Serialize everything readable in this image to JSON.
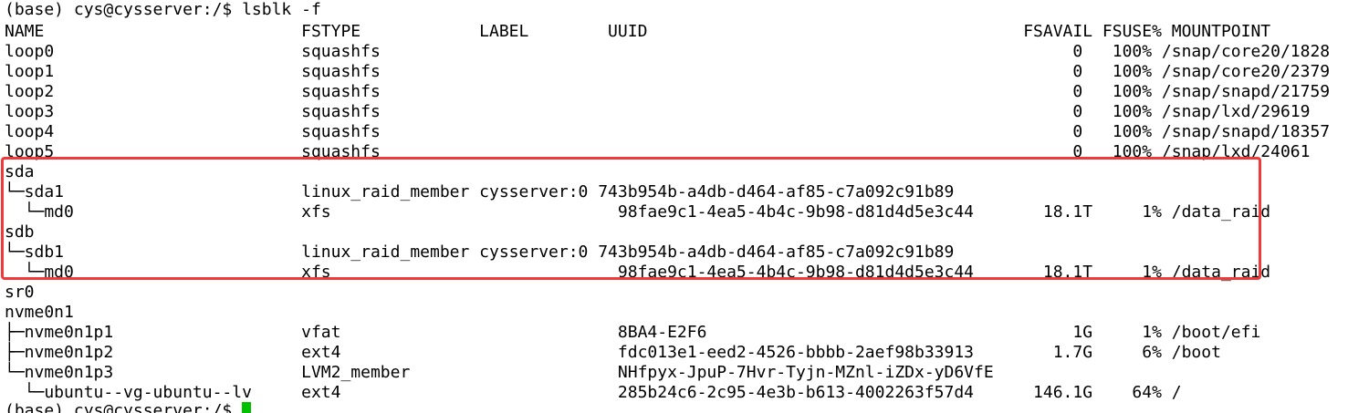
{
  "prompt": "(base) cys@cysserver:/$ lsblk -f",
  "columns": [
    "NAME",
    "FSTYPE",
    "LABEL",
    "UUID",
    "FSAVAIL",
    "FSUSE%",
    "MOUNTPOINT"
  ],
  "header_line": "NAME                          FSTYPE            LABEL        UUID                                      FSAVAIL FSUSE% MOUNTPOINT",
  "rows": [
    {
      "name": "loop0",
      "text": "loop0                         squashfs                                                                      0   100% /snap/core20/1828"
    },
    {
      "name": "loop1",
      "text": "loop1                         squashfs                                                                      0   100% /snap/core20/2379"
    },
    {
      "name": "loop2",
      "text": "loop2                         squashfs                                                                      0   100% /snap/snapd/21759"
    },
    {
      "name": "loop3",
      "text": "loop3                         squashfs                                                                      0   100% /snap/lxd/29619"
    },
    {
      "name": "loop4",
      "text": "loop4                         squashfs                                                                      0   100% /snap/snapd/18357"
    },
    {
      "name": "loop5",
      "text": "loop5                         squashfs                                                                      0   100% /snap/lxd/24061"
    },
    {
      "name": "sda",
      "text": "sda"
    },
    {
      "name": "sda1",
      "text": "└─sda1                        linux_raid_member cysserver:0 743b954b-a4db-d464-af85-c7a092c91b89"
    },
    {
      "name": "md0",
      "text": "  └─md0                       xfs                             98fae9c1-4ea5-4b4c-9b98-d81d4d5e3c44       18.1T     1% /data_raid"
    },
    {
      "name": "sdb",
      "text": "sdb"
    },
    {
      "name": "sdb1",
      "text": "└─sdb1                        linux_raid_member cysserver:0 743b954b-a4db-d464-af85-c7a092c91b89"
    },
    {
      "name": "md0",
      "text": "  └─md0                       xfs                             98fae9c1-4ea5-4b4c-9b98-d81d4d5e3c44       18.1T     1% /data_raid"
    },
    {
      "name": "sr0",
      "text": "sr0"
    },
    {
      "name": "nvme0n1",
      "text": "nvme0n1"
    },
    {
      "name": "nvme0n1p1",
      "text": "├─nvme0n1p1                   vfat                            8BA4-E2F6                                     1G     1% /boot/efi"
    },
    {
      "name": "nvme0n1p2",
      "text": "├─nvme0n1p2                   ext4                            fdc013e1-eed2-4526-bbbb-2aef98b33913        1.7G     6% /boot"
    },
    {
      "name": "nvme0n1p3",
      "text": "└─nvme0n1p3                   LVM2_member                     NHfpyx-JpuP-7Hvr-Tyjn-MZnl-iZDx-yD6VfE"
    },
    {
      "name": "ubuntu--vg-ubuntu--lv",
      "text": "  └─ubuntu--vg-ubuntu--lv     ext4                            285b24c6-2c95-4e3b-b613-4002263f57d4      146.1G    64% /"
    }
  ],
  "final_prompt": "(base) cys@cysserver:/$ ",
  "colors": {
    "background": "#ffffff",
    "text": "#000000",
    "cursor": "#00c000",
    "highlight_border": "#f03a3a"
  }
}
